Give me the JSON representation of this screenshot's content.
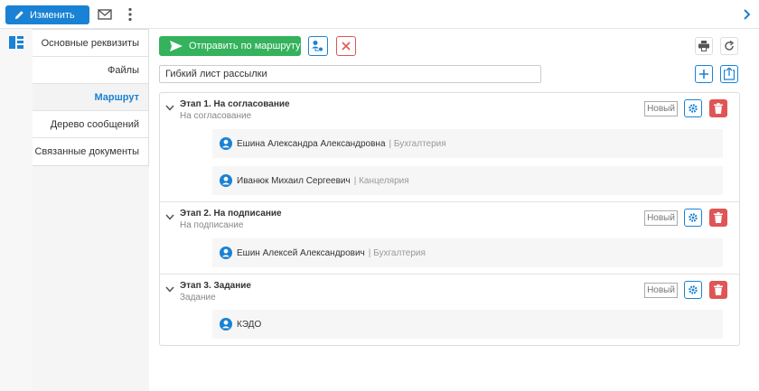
{
  "toolbar": {
    "edit_label": "Изменить",
    "icons": [
      "pencil-icon",
      "mail-icon",
      "more-vertical-icon",
      "chevron-right-icon"
    ]
  },
  "tabs": [
    {
      "label": "Основные реквизиты",
      "active": false
    },
    {
      "label": "Файлы",
      "active": false
    },
    {
      "label": "Маршрут",
      "active": true
    },
    {
      "label": "Дерево сообщений",
      "active": false
    },
    {
      "label": "Связанные документы",
      "active": false
    }
  ],
  "actions": {
    "send_label": "Отправить по маршруту"
  },
  "mailing_list": {
    "value": "Гибкий лист рассылки"
  },
  "stages": [
    {
      "title": "Этап 1. На согласование",
      "subtitle": "На согласование",
      "status": "Новый",
      "participants": [
        {
          "name": "Ешина Александра Александровна",
          "dept": "Бухгалтерия"
        },
        {
          "name": "Иванюк Михаил Сергеевич",
          "dept": "Канцелярия"
        }
      ]
    },
    {
      "title": "Этап 2. На подписание",
      "subtitle": "На подписание",
      "status": "Новый",
      "participants": [
        {
          "name": "Ешин Алексей Александрович",
          "dept": "Бухгалтерия"
        }
      ]
    },
    {
      "title": "Этап 3. Задание",
      "subtitle": "Задание",
      "status": "Новый",
      "participants": [
        {
          "name": "КЭДО",
          "dept": ""
        }
      ]
    }
  ],
  "colors": {
    "primary": "#1a82d4",
    "success": "#34b25c",
    "danger": "#e05555"
  }
}
